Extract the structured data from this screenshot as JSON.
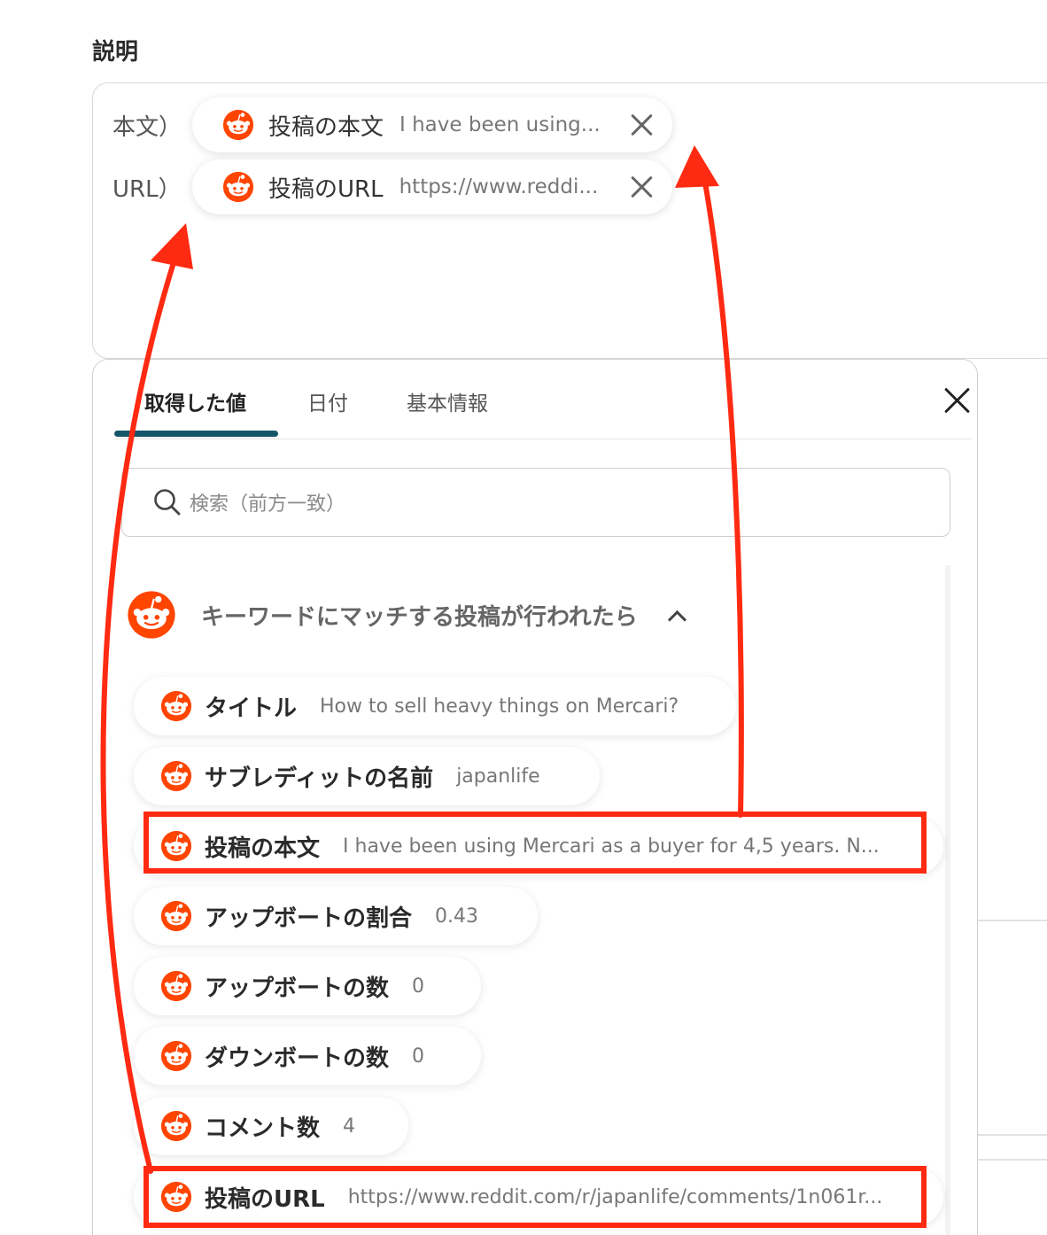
{
  "section": {
    "label": "説明"
  },
  "description": {
    "rows": [
      {
        "prefix": "本文）",
        "chip_label": "投稿の本文",
        "chip_value": "I have been using..."
      },
      {
        "prefix": "URL）",
        "chip_label": "投稿のURL",
        "chip_value": "https://www.reddi..."
      }
    ]
  },
  "panel": {
    "tabs": [
      {
        "label": "取得した値"
      },
      {
        "label": "日付"
      },
      {
        "label": "基本情報"
      }
    ],
    "search": {
      "placeholder": "検索（前方一致）"
    },
    "group": {
      "title": "キーワードにマッチする投稿が行われたら"
    },
    "items": [
      {
        "label": "タイトル",
        "value": "How to sell heavy things on Mercari?"
      },
      {
        "label": "サブレディットの名前",
        "value": "japanlife"
      },
      {
        "label": "投稿の本文",
        "value": "I have been using Mercari as a buyer for 4,5 years. N..."
      },
      {
        "label": "アップボートの割合",
        "value": "0.43"
      },
      {
        "label": "アップボートの数",
        "value": "0"
      },
      {
        "label": "ダウンボートの数",
        "value": "0"
      },
      {
        "label": "コメント数",
        "value": "4"
      },
      {
        "label": "投稿のURL",
        "value": "https://www.reddit.com/r/japanlife/comments/1n061r..."
      }
    ]
  },
  "colors": {
    "accent_red": "#ff2a12",
    "tab_underline": "#15556a",
    "reddit_orange": "#ff4500"
  },
  "icons": {
    "item_icon": "reddit-logo-icon",
    "close": "close-icon",
    "search": "search-icon",
    "collapse": "chevron-up-icon"
  }
}
